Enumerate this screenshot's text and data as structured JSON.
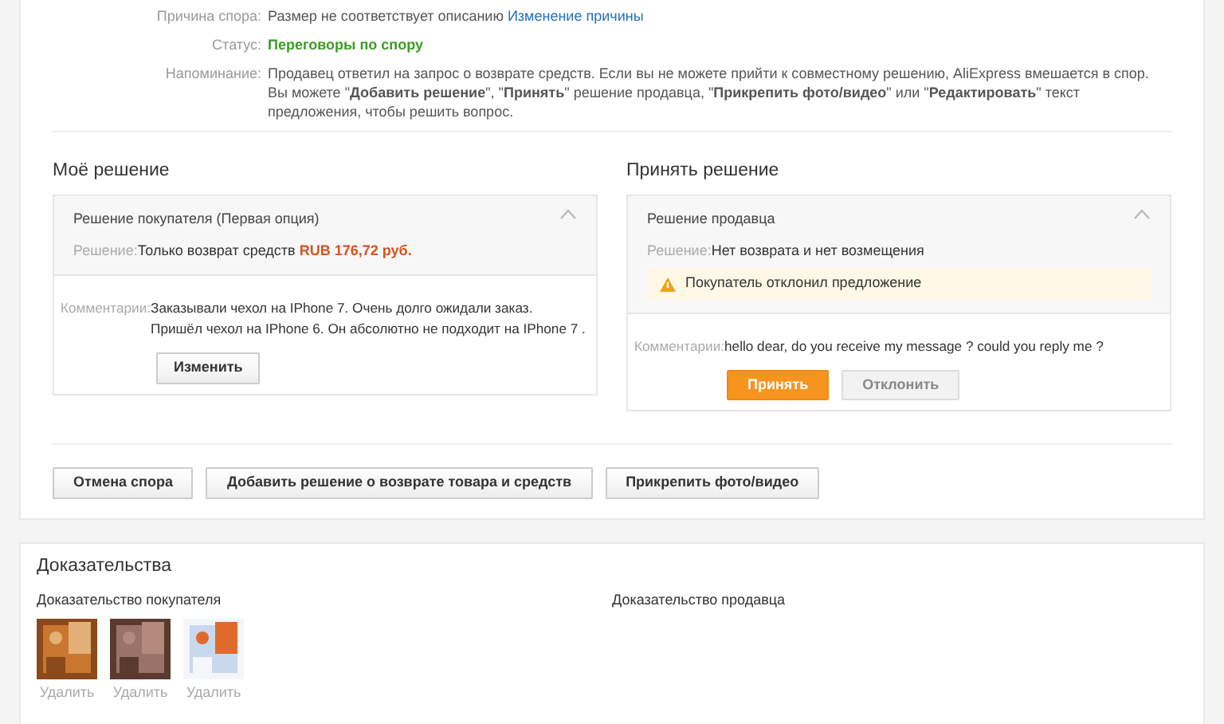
{
  "dispute_info": [
    {
      "label": "Причина спора:",
      "value": "Размер не соответствует описанию",
      "link": "Изменение причины",
      "kind": "text"
    },
    {
      "label": "Статус:",
      "value": "Переговоры по спору",
      "kind": "status"
    },
    {
      "label": "Напоминание:",
      "value": "Продавец ответил на запрос о возврате средств. Если вы не можете прийти к совместному решению, AliExpress вмешается в спор. Вы можете \"**Добавить решение**\", \"**Принять**\" решение продавца, \"**Прикрепить фото/видео**\" или \"**Редактировать**\" текст предложения, чтобы решить вопрос.",
      "kind": "text"
    }
  ],
  "my_solution": {
    "heading": "Моё решение",
    "title": "Решение покупателя (Первая опция)",
    "expanded": true,
    "solution_label": "Решение:",
    "solution": "Только возврат средств",
    "amount": "RUB 176,72 руб.",
    "comment_label": "Комментарии:",
    "comment": "Заказывали чехол на IPhone 7. Очень долго ожидали заказ.\nПришёл чехол на IPhone 6. Он абсолютно не подходит на IPhone 7 .",
    "buttons": [
      {
        "label": "Изменить",
        "kind": "default",
        "disabled": false
      }
    ]
  },
  "seller_solution": {
    "heading": "Принять решение",
    "title": "Решение продавца",
    "expanded": true,
    "solution_label": "Решение:",
    "solution": "Нет возврата и нет возмещения",
    "warning": "Покупатель отклонил предложение",
    "comment_label": "Комментарии:",
    "comment": "hello dear, do you receive my message ? could you reply me ?",
    "buttons": [
      {
        "label": "Принять",
        "kind": "primary",
        "disabled": false
      },
      {
        "label": "Отклонить",
        "kind": "default",
        "disabled": true
      }
    ]
  },
  "actions": [
    "Отмена спора",
    "Добавить решение о возврате товара и средств",
    "Прикрепить фото/видео"
  ],
  "evidence": {
    "heading": "Доказательства",
    "buyer": {
      "title": "Доказательство покупателя",
      "items": [
        {
          "kind": "picture",
          "delete": "Удалить"
        },
        {
          "kind": "picture",
          "delete": "Удалить"
        },
        {
          "kind": "picture",
          "delete": "Удалить"
        }
      ]
    },
    "seller": {
      "title": "Доказательство продавца"
    }
  }
}
